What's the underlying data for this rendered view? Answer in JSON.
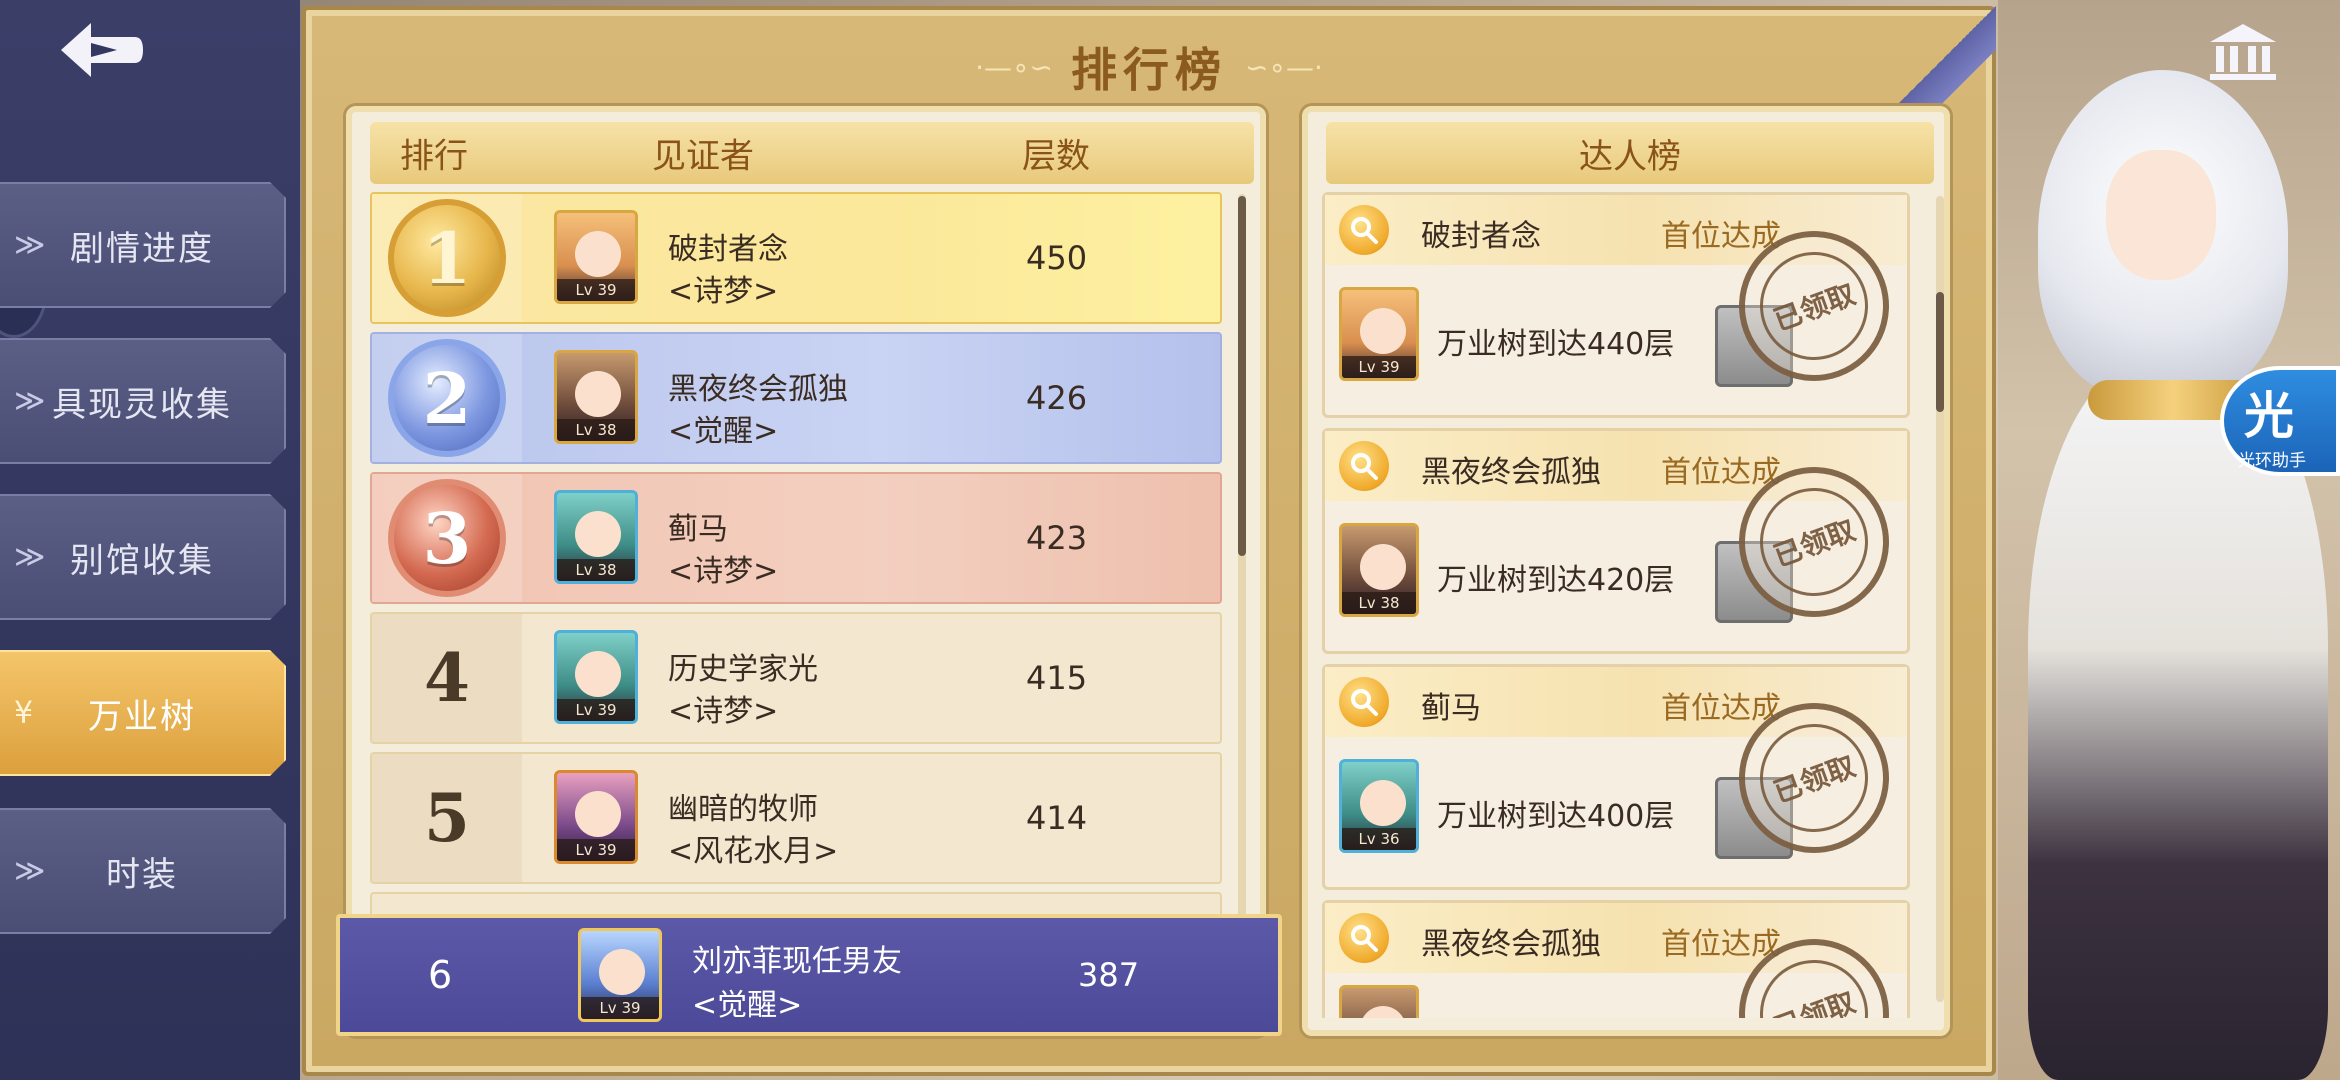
{
  "title": "排行榜",
  "title_ornament_left": "·—∘∽",
  "title_ornament_right": "∽∘—·",
  "nav": [
    {
      "label": "剧情进度",
      "active": false
    },
    {
      "label": "具现灵收集",
      "active": false
    },
    {
      "label": "别馆收集",
      "active": false
    },
    {
      "label": "万业树",
      "active": true
    },
    {
      "label": "时装",
      "active": false
    }
  ],
  "ranking": {
    "headers": {
      "rank": "排行",
      "witness": "见证者",
      "floors": "层数"
    },
    "rows": [
      {
        "rank": "1",
        "name": "破封者念",
        "tag": "<诗梦>",
        "score": "450",
        "level": "Lv 39"
      },
      {
        "rank": "2",
        "name": "黑夜终会孤独",
        "tag": "<觉醒>",
        "score": "426",
        "level": "Lv 38"
      },
      {
        "rank": "3",
        "name": "蓟马",
        "tag": "<诗梦>",
        "score": "423",
        "level": "Lv 38"
      },
      {
        "rank": "4",
        "name": "历史学家光",
        "tag": "<诗梦>",
        "score": "415",
        "level": "Lv 39"
      },
      {
        "rank": "5",
        "name": "幽暗的牧师",
        "tag": "<风花水月>",
        "score": "414",
        "level": "Lv 39"
      }
    ],
    "scroll_position": 0.0
  },
  "my_rank": {
    "rank": "6",
    "name": "刘亦菲现任男友",
    "tag": "<觉醒>",
    "score": "387",
    "level": "Lv 39"
  },
  "experts": {
    "header": "达人榜",
    "first_label": "首位达成",
    "stamp_text": "已领取",
    "cards": [
      {
        "name": "破封者念",
        "achievement": "万业树到达440层",
        "level": "Lv 39"
      },
      {
        "name": "黑夜终会孤独",
        "achievement": "万业树到达420层",
        "level": "Lv 38"
      },
      {
        "name": "蓟马",
        "achievement": "万业树到达400层",
        "level": "Lv 36"
      },
      {
        "name": "黑夜终会孤独",
        "achievement": "",
        "level": ""
      }
    ]
  },
  "helper_badge": {
    "main": "光",
    "sub": "光环助手"
  },
  "colors": {
    "sidebar_bg": "#343860",
    "active_nav": "#e8b24e",
    "panel_gold": "#d3b26e",
    "my_rank_bg": "#5553a0",
    "title_text": "#8a5a1e"
  },
  "icons": {
    "back": "back-arrow-icon",
    "museum": "museum-icon",
    "search": "magnifier-icon",
    "nav_chevron": "double-chevron-icon"
  }
}
